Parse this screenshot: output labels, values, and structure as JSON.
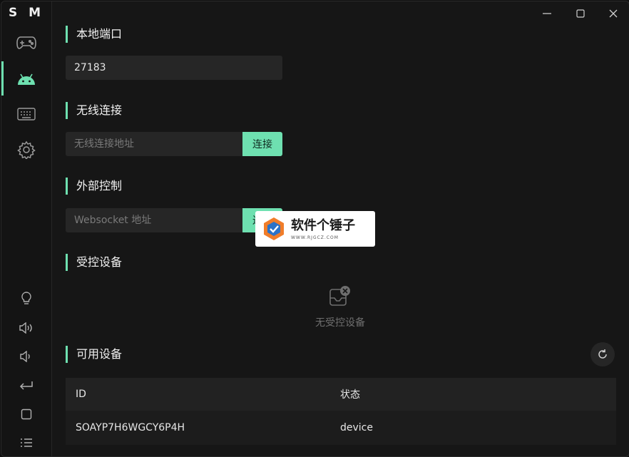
{
  "app": {
    "logo": "S M"
  },
  "colors": {
    "accent": "#6ee0b0",
    "background": "#161616",
    "field": "#262626"
  },
  "sidebar": {
    "nav": [
      {
        "name": "gamepad-icon",
        "active": false
      },
      {
        "name": "android-icon",
        "active": true
      },
      {
        "name": "keyboard-icon",
        "active": false
      },
      {
        "name": "gear-icon",
        "active": false
      }
    ],
    "tools": [
      "bulb-icon",
      "volume-up-icon",
      "volume-down-icon",
      "back-icon",
      "square-icon",
      "menu-list-icon"
    ]
  },
  "window_controls": [
    "minimize-icon",
    "maximize-icon",
    "close-icon"
  ],
  "local_port": {
    "title": "本地端口",
    "value": "27183"
  },
  "wireless": {
    "title": "无线连接",
    "placeholder": "无线连接地址",
    "button": "连接"
  },
  "external": {
    "title": "外部控制",
    "placeholder": "Websocket 地址",
    "button": "连接"
  },
  "controlled": {
    "title": "受控设备",
    "empty_text": "无受控设备"
  },
  "available": {
    "title": "可用设备",
    "columns": [
      "ID",
      "状态"
    ],
    "rows": [
      {
        "id": "SOAYP7H6WGCY6P4H",
        "status": "device"
      }
    ]
  },
  "watermark": {
    "title": "软件个锤子",
    "url": "WWW.RJGCZ.COM"
  }
}
